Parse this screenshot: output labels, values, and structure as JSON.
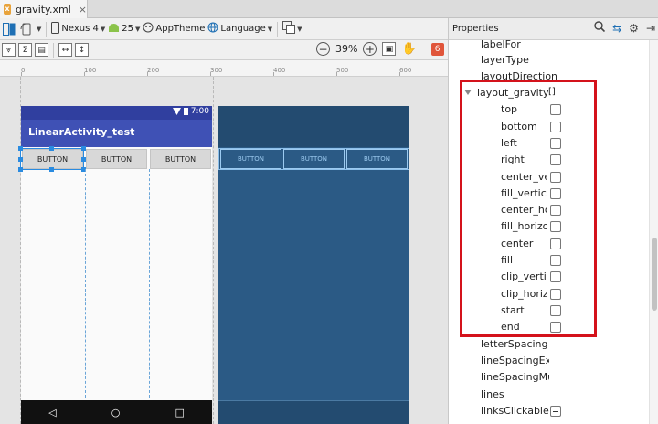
{
  "tab": {
    "title": "gravity.xml",
    "icon": "xml-file-icon"
  },
  "toolbar": {
    "device": "Nexus 4",
    "api": "25",
    "theme": "AppTheme",
    "language": "Language"
  },
  "toolbar2": {
    "zoom": "39%",
    "error_count": "6"
  },
  "ruler": {
    "marks": [
      "0",
      "100",
      "200",
      "300",
      "400",
      "500",
      "600"
    ]
  },
  "device_preview": {
    "time": "7:00",
    "app_title": "LinearActivity_test",
    "buttons": [
      "BUTTON",
      "BUTTON",
      "BUTTON"
    ]
  },
  "blueprint": {
    "buttons": [
      "BUTTON",
      "BUTTON",
      "BUTTON"
    ]
  },
  "properties": {
    "title": "Properties",
    "rows_before": [
      "labelFor",
      "layerType",
      "layoutDirection"
    ],
    "expanded": {
      "name": "layout_gravity",
      "value": "[]",
      "flags": [
        "top",
        "bottom",
        "left",
        "right",
        "center_vertical",
        "fill_vertical",
        "center_horizontal",
        "fill_horizontal",
        "center",
        "fill",
        "clip_vertical",
        "clip_horizontal",
        "start",
        "end"
      ]
    },
    "rows_after": [
      "letterSpacing",
      "lineSpacingExtra",
      "lineSpacingMultiplier",
      "lines",
      "linksClickable"
    ]
  },
  "colors": {
    "app_bar": "#3f51b5",
    "status_bar": "#303f9f",
    "blueprint": "#2b5a85",
    "highlight": "#d4121b",
    "selection": "#2a8be0"
  }
}
